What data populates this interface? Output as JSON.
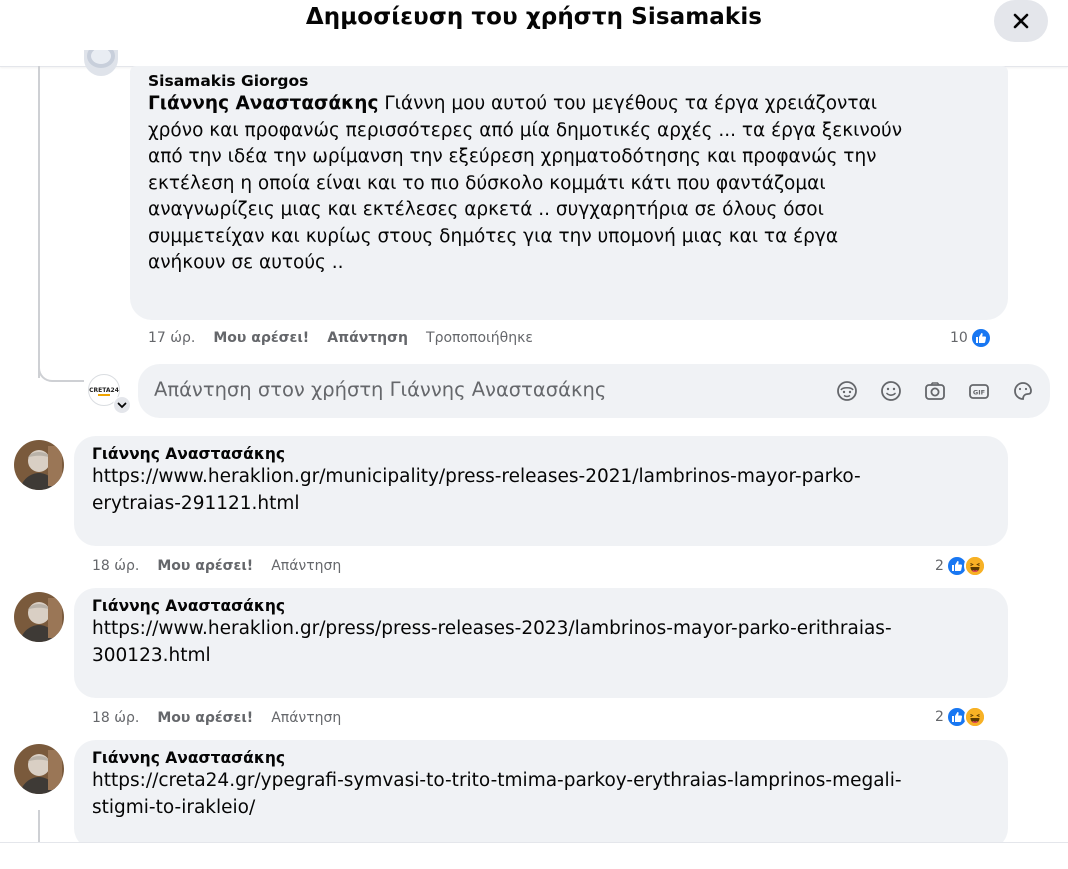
{
  "header": {
    "title": "Δημοσίευση του χρήστη Sisamakis",
    "close_icon": "close-x-icon"
  },
  "colors": {
    "bubble_bg": "#f0f2f5",
    "like_blue": "#1877f2",
    "haha_yellow": "#f7b125",
    "meta_gray": "#65676b"
  },
  "comments": [
    {
      "author": "Sisamakis Giorgos",
      "mention": "Γιάννης Αναστασάκης",
      "text_lines": [
        " Γιάννη μου αυτού του μεγέθους τα έργα χρειάζονται",
        "χρόνο και προφανώς περισσότερες από μία δημοτικές αρχές ... τα έργα ξεκινούν",
        "από την ιδέα την ωρίμανση την εξεύρεση χρηματοδότησης και προφανώς την",
        "εκτέλεση η οποία είναι και το πιο δύσκολο κομμάτι κάτι που φαντάζομαι",
        "αναγνωρίζεις μιας και εκτέλεσες αρκετά .. συγχαρητήρια σε όλους όσοι",
        "συμμετείχαν και κυρίως στους δημότες για την υπομονή μιας και τα έργα",
        "ανήκουν σε αυτούς .."
      ],
      "time": "17 ώρ.",
      "like": "Μου αρέσει!",
      "reply": "Απάντηση",
      "edited": "Τροποποιήθηκε",
      "reaction_count": "10"
    },
    {
      "author": "Γιάννης Αναστασάκης",
      "text_lines": [
        "https://www.heraklion.gr/municipality/press-releases-2021/lambrinos-mayor-parko-",
        "erytraias-291121.html"
      ],
      "time": "18 ώρ.",
      "like": "Μου αρέσει!",
      "reply": "Απάντηση",
      "reaction_count": "2"
    },
    {
      "author": "Γιάννης Αναστασάκης",
      "text_lines": [
        "https://www.heraklion.gr/press/press-releases-2023/lambrinos-mayor-parko-erithraias-",
        "300123.html"
      ],
      "time": "18 ώρ.",
      "like": "Μου αρέσει!",
      "reply": "Απάντηση",
      "reaction_count": "2"
    },
    {
      "author": "Γιάννης Αναστασάκης",
      "text_lines": [
        "https://creta24.gr/ypegrafi-symvasi-to-trito-tmima-parkoy-erythraias-lamprinos-megali-",
        "stigmi-to-irakleio/"
      ]
    }
  ],
  "reply_box": {
    "placeholder": "Απάντηση στον χρήστη Γιάννης Αναστασάκης",
    "avatar_logo_text": "CRETA24",
    "tools": [
      "avatar-sticker-icon",
      "emoji-icon",
      "camera-icon",
      "gif-icon",
      "sticker-icon"
    ]
  }
}
